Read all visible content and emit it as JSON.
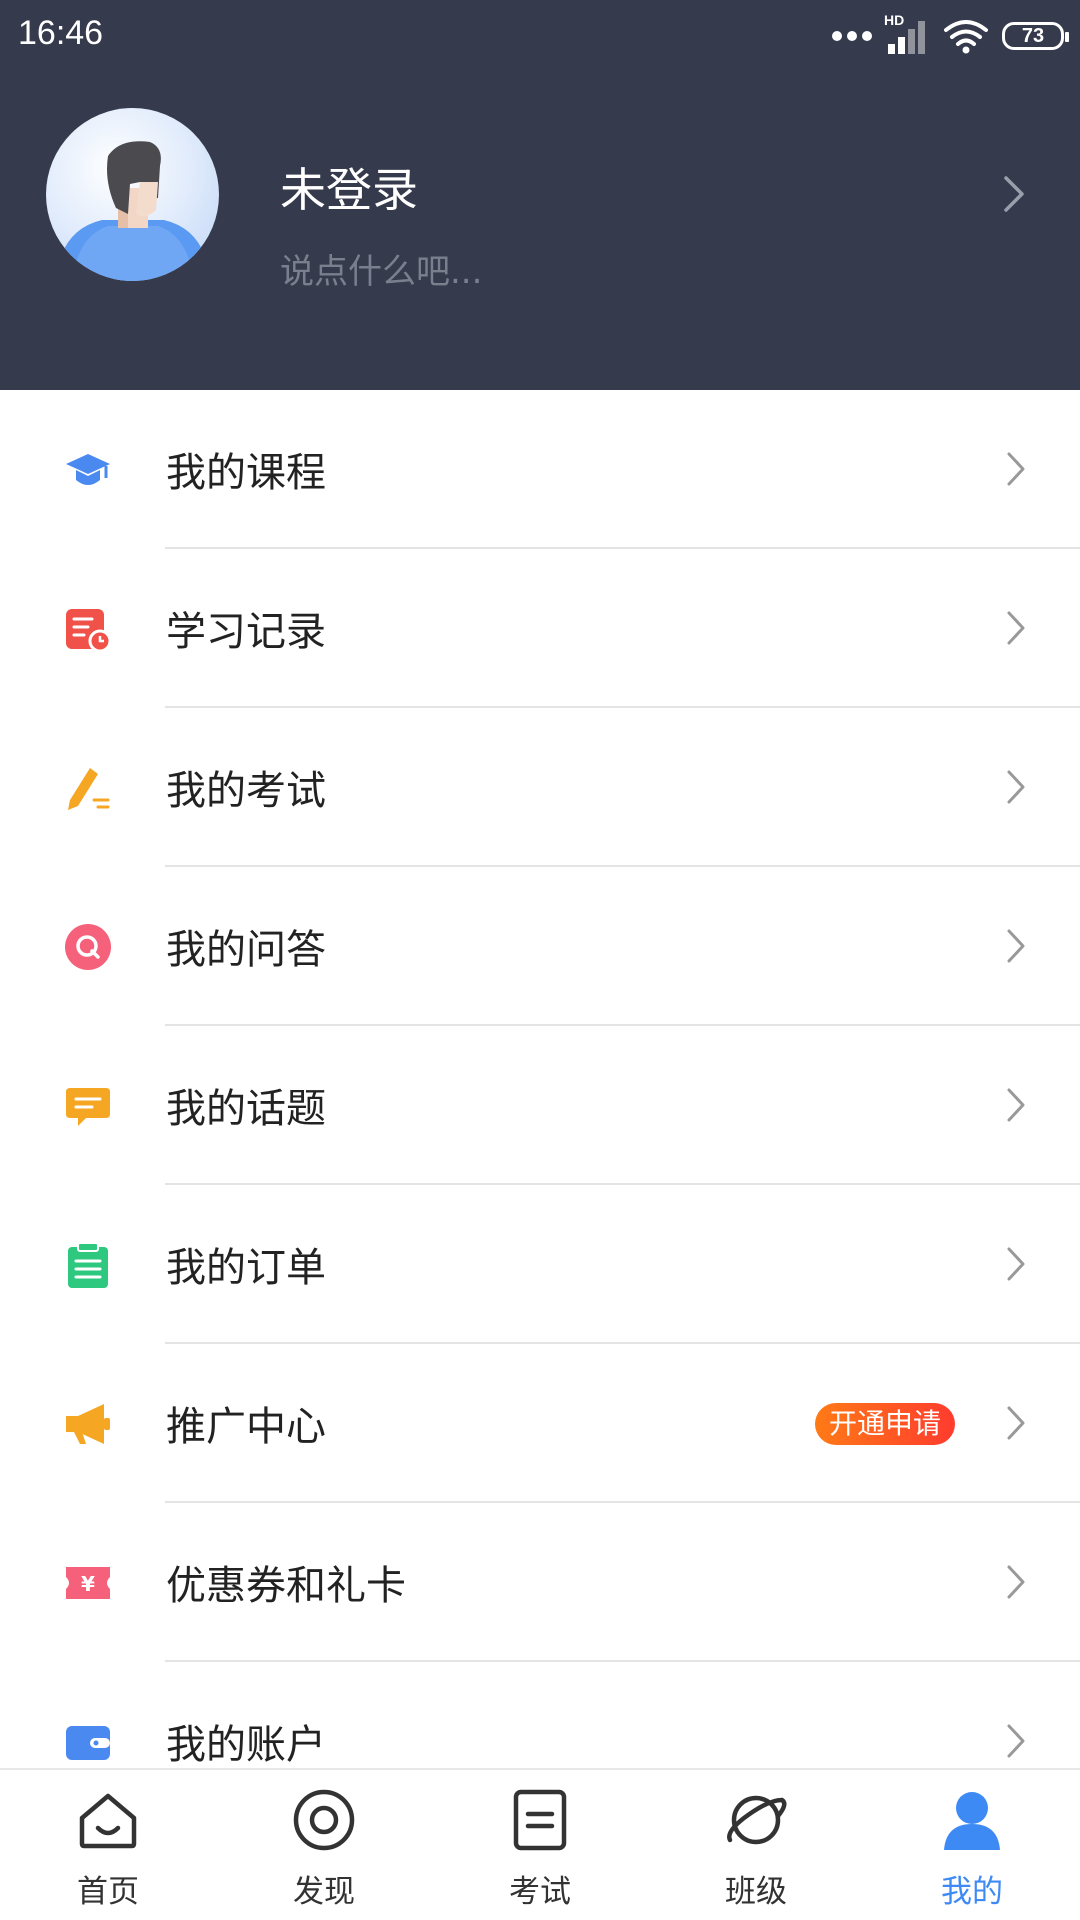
{
  "status_bar": {
    "time": "16:46",
    "signal_label": "HD",
    "battery": "73"
  },
  "profile": {
    "name": "未登录",
    "subtitle": "说点什么吧..."
  },
  "menu": [
    {
      "label": "我的课程",
      "icon": "graduation-cap-icon",
      "color": "#4a8af0"
    },
    {
      "label": "学习记录",
      "icon": "study-record-icon",
      "color": "#f0524a"
    },
    {
      "label": "我的考试",
      "icon": "pencil-icon",
      "color": "#f5a623"
    },
    {
      "label": "我的问答",
      "icon": "qa-icon",
      "color": "#f5607a"
    },
    {
      "label": "我的话题",
      "icon": "chat-bubble-icon",
      "color": "#f5a623"
    },
    {
      "label": "我的订单",
      "icon": "clipboard-icon",
      "color": "#2ec87e"
    },
    {
      "label": "推广中心",
      "icon": "megaphone-icon",
      "color": "#f5a623",
      "badge": "开通申请"
    },
    {
      "label": "优惠券和礼卡",
      "icon": "coupon-icon",
      "color": "#f5607a"
    },
    {
      "label": "我的账户",
      "icon": "wallet-icon",
      "color": "#4a8af0"
    }
  ],
  "tabs": [
    {
      "label": "首页",
      "icon": "home-icon"
    },
    {
      "label": "发现",
      "icon": "discover-icon"
    },
    {
      "label": "考试",
      "icon": "exam-icon"
    },
    {
      "label": "班级",
      "icon": "class-planet-icon"
    },
    {
      "label": "我的",
      "icon": "profile-icon",
      "active": true
    }
  ],
  "colors": {
    "header_bg": "#353a4c",
    "accent": "#3e8af5",
    "badge_gradient_start": "#ff7a16",
    "badge_gradient_end": "#ff3b2e"
  }
}
